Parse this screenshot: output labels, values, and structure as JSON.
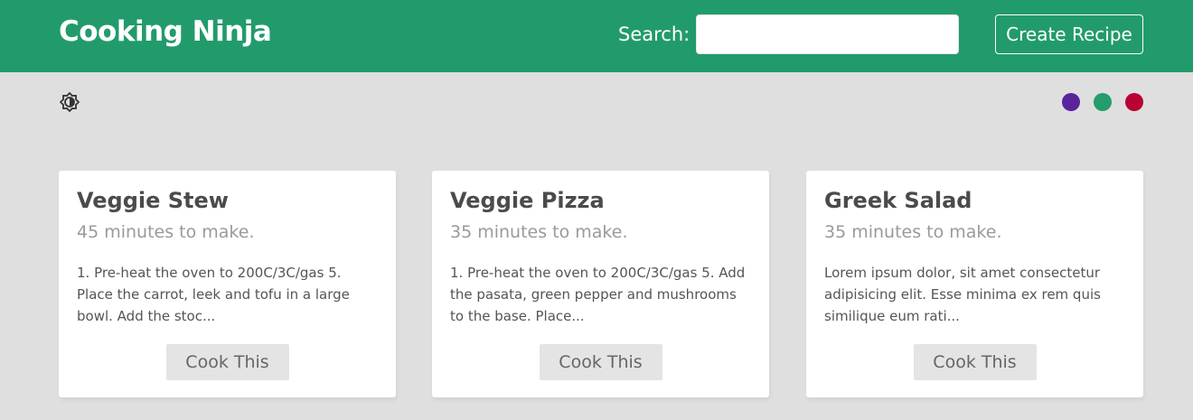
{
  "header": {
    "brand": "Cooking Ninja",
    "search_label": "Search:",
    "search_value": "",
    "search_placeholder": "",
    "create_label": "Create Recipe",
    "bg_color": "#229b6c"
  },
  "toolbar": {
    "mode_icon": "brightness-mode-icon",
    "theme_colors": [
      "#58249c",
      "#249c6b",
      "#b70233"
    ]
  },
  "recipes": [
    {
      "title": "Veggie Stew",
      "time": "45 minutes to make.",
      "snippet": "1. Pre-heat the oven to 200C/3C/gas 5. Place the carrot, leek and tofu in a large bowl. Add the stoc...",
      "button": "Cook This"
    },
    {
      "title": "Veggie Pizza",
      "time": "35 minutes to make.",
      "snippet": "1. Pre-heat the oven to 200C/3C/gas 5. Add the pasata, green pepper and mushrooms to the base. Place...",
      "button": "Cook This"
    },
    {
      "title": "Greek Salad",
      "time": "35 minutes to make.",
      "snippet": "Lorem ipsum dolor, sit amet consectetur adipisicing elit. Esse minima ex rem quis similique eum rati...",
      "button": "Cook This"
    }
  ]
}
